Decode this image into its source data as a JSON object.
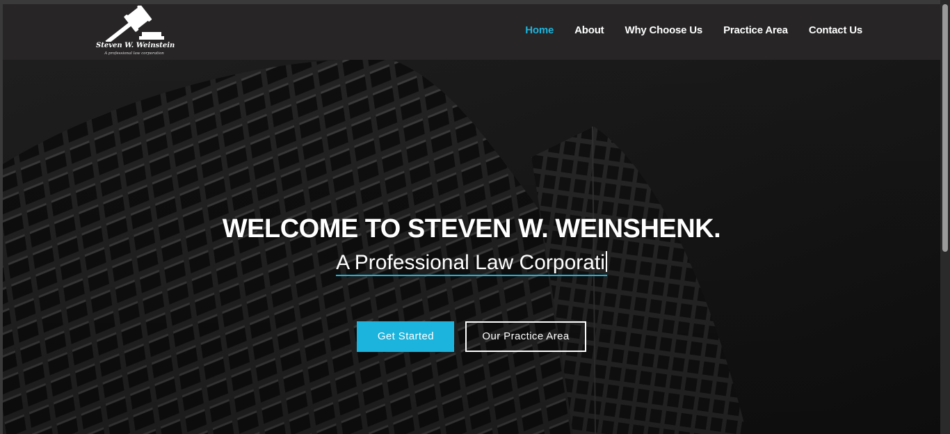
{
  "logo": {
    "name": "Steven W. Weinstein",
    "tagline": "A professional law corporation"
  },
  "nav": [
    {
      "label": "Home",
      "active": true
    },
    {
      "label": "About",
      "active": false
    },
    {
      "label": "Why Choose Us",
      "active": false
    },
    {
      "label": "Practice Area",
      "active": false
    },
    {
      "label": "Contact Us",
      "active": false
    }
  ],
  "hero": {
    "title": "WELCOME TO STEVEN W. WEINSHENK.",
    "subtitle": "A Professional Law Corporati",
    "primary_button": "Get Started",
    "secondary_button": "Our Practice Area"
  },
  "colors": {
    "accent": "#1cb4dc",
    "header_bg": "#272526"
  }
}
